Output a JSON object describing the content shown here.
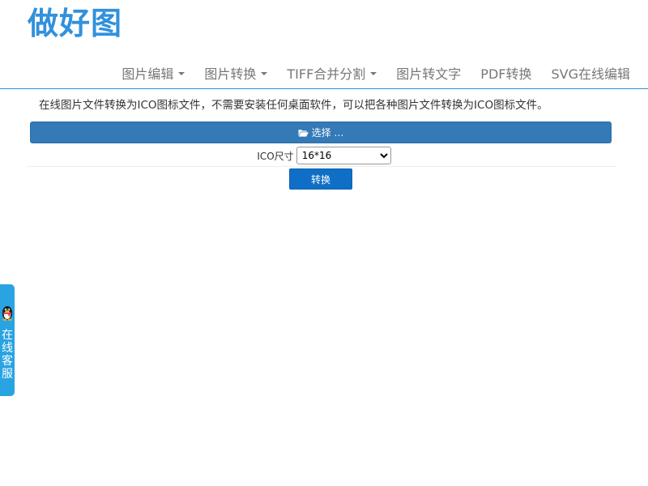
{
  "header": {
    "logo_text": "做好图",
    "nav": [
      {
        "label": "图片编辑",
        "has_dropdown": true
      },
      {
        "label": "图片转换",
        "has_dropdown": true
      },
      {
        "label": "TIFF合并分割",
        "has_dropdown": true
      },
      {
        "label": "图片转文字",
        "has_dropdown": false
      },
      {
        "label": "PDF转换",
        "has_dropdown": false
      },
      {
        "label": "SVG在线编辑",
        "has_dropdown": false
      }
    ]
  },
  "main": {
    "description": "在线图片文件转换为ICO图标文件，不需要安装任何桌面软件，可以把各种图片文件转换为ICO图标文件。",
    "select_file": {
      "label": "选择 …",
      "icon": "folder-open-icon"
    },
    "size": {
      "label": "ICO尺寸",
      "selected": "16*16",
      "options": [
        "16*16"
      ]
    },
    "convert_label": "转换"
  },
  "service": {
    "label": "在线客服",
    "icon": "qq-penguin-icon"
  },
  "colors": {
    "brand": "#3191dc",
    "primary_button": "#337ab7",
    "convert_button": "#0f6fc6",
    "service_tab": "#29a3e2",
    "nav_text": "#777777"
  }
}
